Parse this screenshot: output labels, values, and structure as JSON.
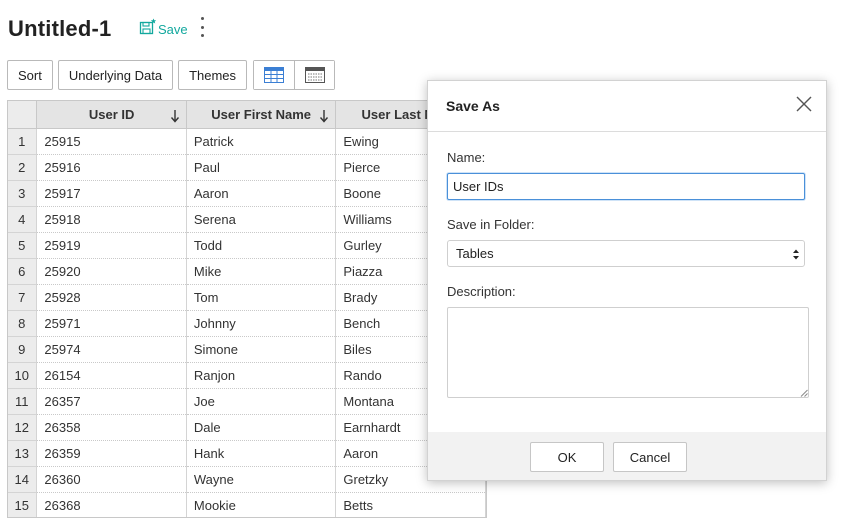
{
  "document": {
    "title": "Untitled-1",
    "save_label": "Save"
  },
  "toolbar": {
    "sort": "Sort",
    "underlying_data": "Underlying Data",
    "themes": "Themes"
  },
  "table": {
    "columns": [
      "User ID",
      "User First Name",
      "User Last Name"
    ],
    "rows": [
      [
        "1",
        "25915",
        "Patrick",
        "Ewing"
      ],
      [
        "2",
        "25916",
        "Paul",
        "Pierce"
      ],
      [
        "3",
        "25917",
        "Aaron",
        "Boone"
      ],
      [
        "4",
        "25918",
        "Serena",
        "Williams"
      ],
      [
        "5",
        "25919",
        "Todd",
        "Gurley"
      ],
      [
        "6",
        "25920",
        "Mike",
        "Piazza"
      ],
      [
        "7",
        "25928",
        "Tom",
        "Brady"
      ],
      [
        "8",
        "25971",
        "Johnny",
        "Bench"
      ],
      [
        "9",
        "25974",
        "Simone",
        "Biles"
      ],
      [
        "10",
        "26154",
        "Ranjon",
        "Rando"
      ],
      [
        "11",
        "26357",
        "Joe",
        "Montana"
      ],
      [
        "12",
        "26358",
        "Dale",
        "Earnhardt"
      ],
      [
        "13",
        "26359",
        "Hank",
        "Aaron"
      ],
      [
        "14",
        "26360",
        "Wayne",
        "Gretzky"
      ],
      [
        "15",
        "26368",
        "Mookie",
        "Betts"
      ]
    ]
  },
  "dialog": {
    "title": "Save As",
    "name_label": "Name:",
    "name_value": "User IDs",
    "folder_label": "Save in Folder:",
    "folder_value": "Tables",
    "description_label": "Description:",
    "description_value": "",
    "ok": "OK",
    "cancel": "Cancel"
  },
  "colors": {
    "accent": "#13a89e",
    "focus": "#4a90d9",
    "view_icon": "#3b7fd4"
  }
}
